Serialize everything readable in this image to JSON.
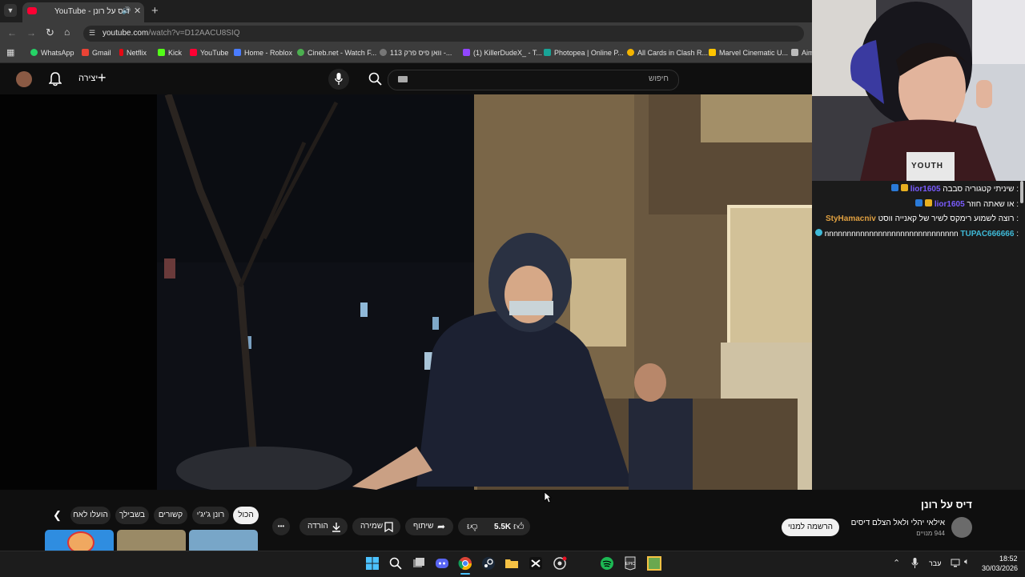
{
  "browser": {
    "tab_title": "YouTube - דיס על רונן",
    "url_host": "youtube.com",
    "url_path": "/watch?v=D12AACU8SIQ",
    "new_tab": "+",
    "bookmarks": [
      "WhatsApp",
      "Gmail",
      "Netflix",
      "Kick",
      "YouTube",
      "Home - Roblox",
      "Cineb.net - Watch F...",
      "וואן פיס פרק 113 -...",
      "(1) KillerDudeX_ - T...",
      "Photopea | Online P...",
      "All Cards in Clash R...",
      "Marvel Cinematic U...",
      "Aim"
    ]
  },
  "youtube": {
    "create_label": "יצירה",
    "search_placeholder": "חיפוש"
  },
  "video": {
    "title": "דיס על רונן",
    "channel_name": "אילאי יהלי ולאל הצלם דיסים",
    "subscribers": "944 מנויים",
    "subscribe_label": "הרשמה למנוי",
    "likes": "5.5K",
    "share_label": "שיתוף",
    "save_label": "שמירה",
    "download_label": "הורדה",
    "more_label": "•••"
  },
  "chips": [
    "הכול",
    "רונן ג'יג'י",
    "קשורים",
    "בשבילך",
    "הועלו לאח"
  ],
  "chat": [
    {
      "user": "lior1605",
      "msg": ": שיניתי קטגוריה סבבה",
      "color": "#7a5cff"
    },
    {
      "user": "lior1605",
      "msg": ": או שאתה חוזר",
      "color": "#7a5cff"
    },
    {
      "user": "StyHamacniv",
      "msg": ": רוצה לשמוע רימקס לשיר של קאנייה ווסט",
      "color": "#e0a040"
    },
    {
      "user": "TUPAC666666",
      "msg": ": nnnnnnnnnnnnnnnnnnnnnnnnnnnnnn",
      "color": "#3fbad8"
    }
  ],
  "webcam": {
    "shirt_text": "YOUTH"
  },
  "taskbar": {
    "lang": "עבר",
    "time": "18:52",
    "date": "30/03/2026"
  },
  "colors": {
    "youtube_red": "#ff0033",
    "chrome_bg": "#3c3c3c"
  }
}
